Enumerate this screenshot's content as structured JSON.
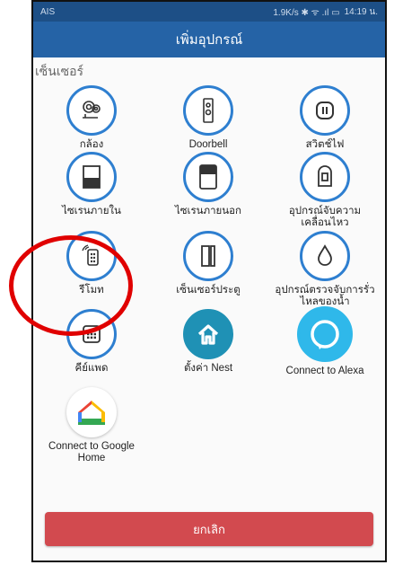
{
  "status_bar": {
    "carrier": "AIS",
    "indicators": "1.9K/s ✱ ᯤ .ıl ▭",
    "time": "14:19 น."
  },
  "header": {
    "title": "เพิ่มอุปกรณ์"
  },
  "section_label": "เซ็นเซอร์",
  "devices": [
    {
      "label": "กล้อง",
      "icon": "camera-icon"
    },
    {
      "label": "Doorbell",
      "icon": "doorbell-icon"
    },
    {
      "label": "สวิตช์ไฟ",
      "icon": "switch-icon"
    },
    {
      "label": "ไซเรนภายใน",
      "icon": "indoor-siren-icon"
    },
    {
      "label": "ไซเรนภายนอก",
      "icon": "outdoor-siren-icon"
    },
    {
      "label": "อุปกรณ์จับความ\nเคลื่อนไหว",
      "icon": "motion-sensor-icon"
    },
    {
      "label": "รีโมท",
      "icon": "remote-icon"
    },
    {
      "label": "เซ็นเซอร์ประตู",
      "icon": "door-sensor-icon"
    },
    {
      "label": "อุปกรณ์ตรวจจับการรั่ว\nไหลของน้ำ",
      "icon": "water-leak-icon"
    },
    {
      "label": "คีย์แพด",
      "icon": "keypad-icon"
    },
    {
      "label": "ตั้งค่า Nest",
      "icon": "nest-icon"
    },
    {
      "label": "Connect to Alexa",
      "icon": "alexa-icon"
    },
    {
      "label": "Connect to Google\nHome",
      "icon": "google-home-icon"
    }
  ],
  "cancel_label": "ยกเลิก",
  "colors": {
    "appbar": "#2563a6",
    "accent": "#2e7fd0",
    "cancel": "#d24a4f",
    "annotation": "#e00000"
  }
}
